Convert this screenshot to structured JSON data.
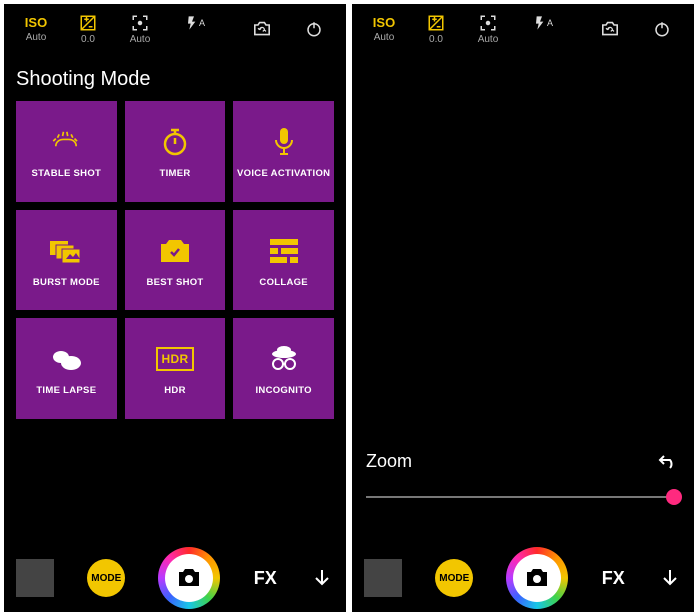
{
  "topbar": {
    "iso_label": "ISO",
    "iso_value": "Auto",
    "exposure_value": "0.0",
    "focus_value": "Auto"
  },
  "left": {
    "section_title": "Shooting Mode",
    "modes": [
      "STABLE SHOT",
      "TIMER",
      "VOICE ACTIVATION",
      "BURST MODE",
      "BEST SHOT",
      "COLLAGE",
      "TIME LAPSE",
      "HDR",
      "INCOGNITO"
    ]
  },
  "right": {
    "zoom_label": "Zoom"
  },
  "bottom": {
    "mode_btn": "MODE",
    "fx_label": "FX"
  }
}
